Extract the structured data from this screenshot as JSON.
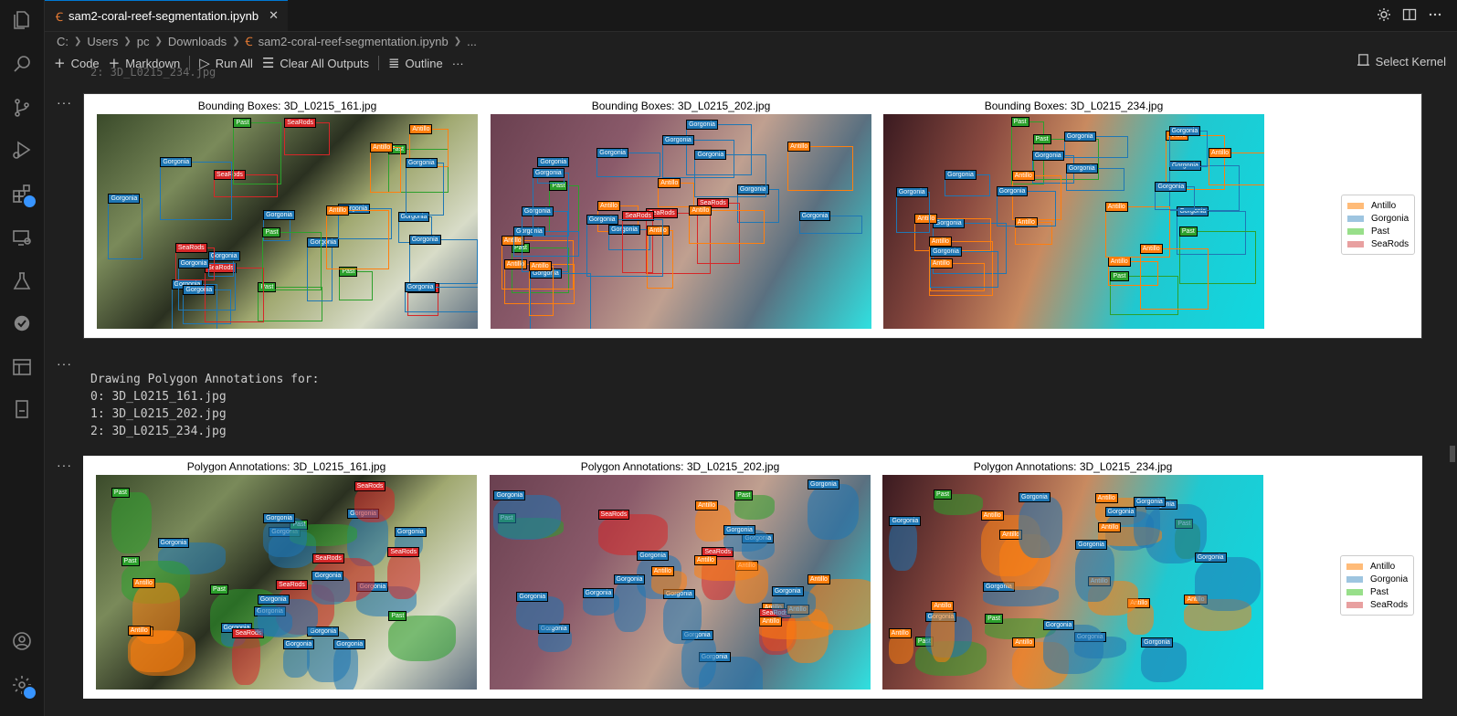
{
  "tab": {
    "label": "sam2-coral-reef-segmentation.ipynb",
    "close": "✕"
  },
  "breadcrumb": [
    "C:",
    "Users",
    "pc",
    "Downloads",
    "sam2-coral-reef-segmentation.ipynb",
    "..."
  ],
  "toolbar": {
    "code_label": "Code",
    "markdown_label": "Markdown",
    "run_all_label": "Run All",
    "clear_outputs_label": "Clear All Outputs",
    "outline_label": "Outline",
    "more_label": "···",
    "select_kernel_label": "Select Kernel"
  },
  "ghost_line": "2: 3D_L0215_234.jpg",
  "cells": {
    "cell1_dots": "···",
    "cell2_dots": "···",
    "cell3_dots": "···"
  },
  "bbox_titles": [
    "Bounding Boxes: 3D_L0215_161.jpg",
    "Bounding Boxes: 3D_L0215_202.jpg",
    "Bounding Boxes: 3D_L0215_234.jpg"
  ],
  "poly_titles": [
    "Polygon Annotations: 3D_L0215_161.jpg",
    "Polygon Annotations: 3D_L0215_202.jpg",
    "Polygon Annotations: 3D_L0215_234.jpg"
  ],
  "text_output": "Drawing Polygon Annotations for:\n0: 3D_L0215_161.jpg\n1: 3D_L0215_202.jpg\n2: 3D_L0215_234.jpg",
  "legend": [
    {
      "label": "Antillo",
      "color": "#ffbb78"
    },
    {
      "label": "Gorgonia",
      "color": "#9ec5e0"
    },
    {
      "label": "Past",
      "color": "#98df8a"
    },
    {
      "label": "SeaRods",
      "color": "#e8a0a0"
    }
  ],
  "class_colors": {
    "Antillo": "#ff7f0e",
    "Gorgonia": "#1f77b4",
    "Past": "#2ca02c",
    "SeaRods": "#d62728"
  },
  "tags_161": [
    "Gorgonia",
    "Gorgonia",
    "Past",
    "Gorgonia",
    "Past",
    "SeaRods",
    "SeaRods",
    "Gorgonia",
    "SeaRods",
    "Gorgonia",
    "Gorgonia",
    "Past",
    "Gorgonia",
    "Gorgonia",
    "SeaRods",
    "Gorgonia",
    "Gorgonia",
    "Past",
    "Past",
    "Gorgonia",
    "Antillo",
    "Antillo",
    "Antillo",
    "SeaRods",
    "Gorgonia",
    "Gorgonia"
  ],
  "tags_202": [
    "Past",
    "Antillo",
    "SeaRods",
    "Gorgonia",
    "Gorgonia",
    "Antillo",
    "SeaRods",
    "Gorgonia",
    "Past",
    "Gorgonia",
    "Antillo",
    "Gorgonia",
    "Antillo",
    "Gorgonia",
    "Gorgonia",
    "Antillo",
    "Gorgonia",
    "Gorgonia",
    "Gorgonia",
    "SeaRods",
    "Antillo",
    "Gorgonia",
    "Gorgonia",
    "Gorgonia",
    "Antillo",
    "Antillo"
  ],
  "tags_234": [
    "Gorgonia",
    "Past",
    "Past",
    "Antillo",
    "Gorgonia",
    "Past",
    "Past",
    "Gorgonia",
    "Antillo",
    "Antillo",
    "Antillo",
    "Antillo",
    "Gorgonia",
    "Antillo",
    "Gorgonia",
    "Antillo",
    "Antillo",
    "Gorgonia",
    "Gorgonia",
    "Gorgonia",
    "Antillo",
    "Gorgonia",
    "Antillo",
    "Gorgonia",
    "Gorgonia",
    "Gorgonia"
  ]
}
